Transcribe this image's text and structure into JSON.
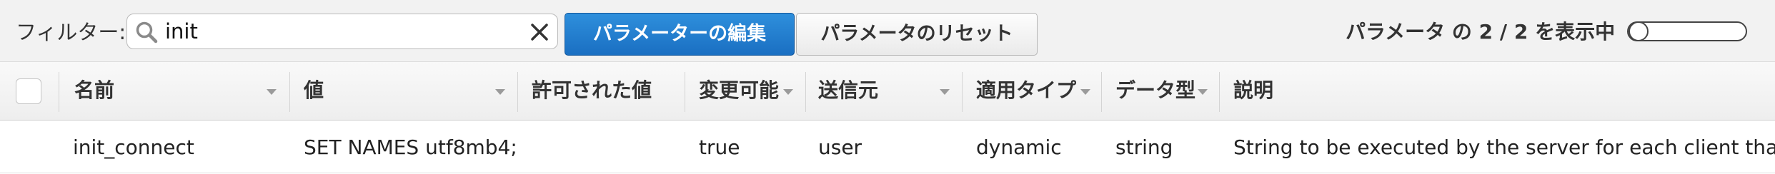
{
  "filter": {
    "label": "フィルター:",
    "value": "init",
    "icon": "search-icon",
    "clear_icon": "close-icon"
  },
  "buttons": {
    "edit": "パラメーターの編集",
    "reset": "パラメータのリセット"
  },
  "status": {
    "count_text": "パラメータ の 2 / 2 を表示中"
  },
  "colors": {
    "primary": "#1a6fc2",
    "toolbar_bg": "#f2f2f2",
    "header_bg": "#eeeeee"
  },
  "table": {
    "columns": [
      "名前",
      "値",
      "許可された値",
      "変更可能",
      "送信元",
      "適用タイプ",
      "データ型",
      "説明"
    ],
    "rows": [
      {
        "name": "init_connect",
        "value": "SET NAMES utf8mb4;",
        "allowed": "",
        "modifiable": "true",
        "source": "user",
        "apply_type": "dynamic",
        "data_type": "string",
        "description": "String to be executed by the server for each client that connects."
      }
    ]
  }
}
